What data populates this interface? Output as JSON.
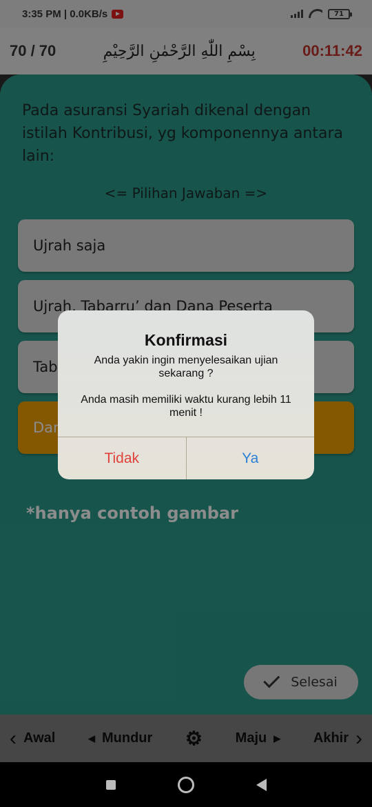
{
  "status_bar": {
    "time_speed": "3:35 PM | 0.0KB/s",
    "battery": "71"
  },
  "header": {
    "counter": "70 / 70",
    "bismillah": "بِسْمِ اللّٰهِ الرَّحْمٰنِ الرَّحِيْمِ",
    "timer": "00:11:42"
  },
  "question": {
    "text": "Pada asuransi Syariah dikenal dengan istilah Kontribusi, yg komponennya antara lain:",
    "choices_hint": "<= Pilihan Jawaban =>"
  },
  "options": [
    {
      "label": "Ujrah saja"
    },
    {
      "label": "Ujrah, Tabarru’ dan Dana Peserta"
    },
    {
      "label": "Tab"
    },
    {
      "label": "Dar"
    }
  ],
  "watermark": "*hanya contoh gambar",
  "finish_button": "Selesai",
  "nav": {
    "first": "Awal",
    "prev": "Mundur",
    "next": "Maju",
    "last": "Akhir"
  },
  "dialog": {
    "title": "Konfirmasi",
    "message": "Anda yakin ingin menyelesaikan ujian sekarang ?\n\nAnda masih memiliki waktu kurang lebih 11 menit !",
    "no_label": "Tidak",
    "yes_label": "Ya"
  },
  "colors": {
    "main_bg": "#2b9a8a",
    "selected_option": "#f0a000",
    "timer": "#c0322b",
    "dialog_no": "#e0413a",
    "dialog_yes": "#2b7fd6"
  }
}
